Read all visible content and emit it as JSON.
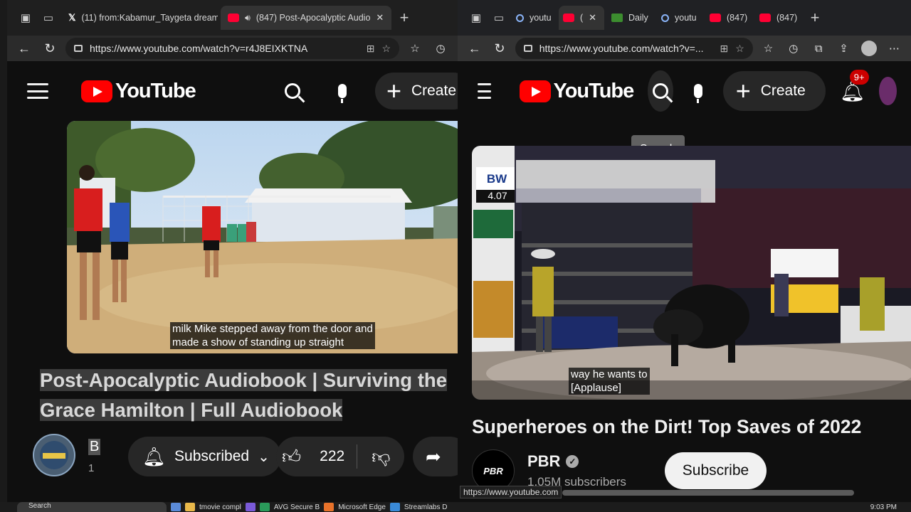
{
  "left_window": {
    "tabs": [
      {
        "label": "(11) from:Kabamur_Taygeta dream",
        "icon": "x-logo-icon",
        "active": false
      },
      {
        "label": "(847) Post-Apocalyptic Audio",
        "icon": "youtube-icon",
        "active": true
      }
    ],
    "url": "https://www.youtube.com/watch?v=r4J8EIXKTNA",
    "header": {
      "logo_text": "YouTube",
      "create_label": "Create"
    },
    "caption_lines": [
      "milk Mike stepped away from the door and",
      "made a show of standing up straight"
    ],
    "video_title": "Post-Apocalyptic Audiobook | Surviving the Grace Hamilton | Full Audiobook",
    "channel": {
      "name": "B",
      "subscribers": "1"
    },
    "subscribed_label": "Subscribed",
    "like_count": "222"
  },
  "right_window": {
    "tabs": [
      {
        "label": "youtu",
        "icon": "search-icon",
        "active": false
      },
      {
        "label": "(",
        "icon": "youtube-icon",
        "active": true
      },
      {
        "label": "Daily",
        "icon": "daily-icon",
        "active": false
      },
      {
        "label": "youtu",
        "icon": "search-icon",
        "active": false
      },
      {
        "label": "(847)",
        "icon": "youtube-icon",
        "active": false
      },
      {
        "label": "(847)",
        "icon": "youtube-icon",
        "active": false
      }
    ],
    "url": "https://www.youtube.com/watch?v=...",
    "header": {
      "logo_text": "YouTube",
      "create_label": "Create",
      "notification_badge": "9+"
    },
    "tooltip": "Search",
    "scoreboard": {
      "brand": "BW",
      "score": "4.07"
    },
    "caption_lines": [
      "way he wants to",
      "[Applause]"
    ],
    "video_title": "Superheroes on the Dirt! Top Saves of 2022",
    "channel": {
      "name": "PBR",
      "subscribers": "1.05M subscribers",
      "avatar_text": "PBR"
    },
    "subscribe_label": "Subscribe"
  },
  "status_bar_url": "https://www.youtube.com",
  "taskbar": {
    "search_placeholder": "Search",
    "items": [
      "tmovie compl",
      "AVG Secure B",
      "Microsoft Edge",
      "Streamlabs D"
    ],
    "clock": "9:03 PM"
  },
  "colors": {
    "youtube_red": "#ff0000",
    "badge_red": "#cc0000",
    "bg": "#0f0f0f"
  }
}
